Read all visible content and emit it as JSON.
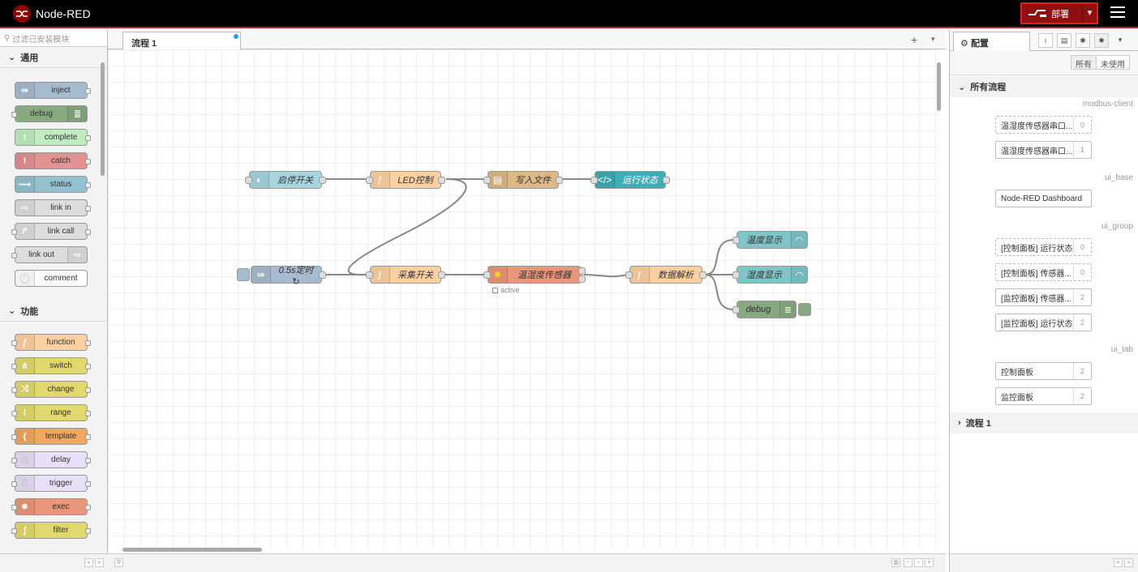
{
  "app": {
    "title": "Node-RED"
  },
  "header": {
    "deploy_label": "部署"
  },
  "palette": {
    "search_placeholder": "过滤已安装模块",
    "categories": [
      {
        "label": "通用",
        "nodes": [
          "inject",
          "debug",
          "complete",
          "catch",
          "status",
          "link in",
          "link call",
          "link out",
          "comment"
        ]
      },
      {
        "label": "功能",
        "nodes": [
          "function",
          "switch",
          "change",
          "range",
          "template",
          "delay",
          "trigger",
          "exec",
          "filter"
        ]
      }
    ]
  },
  "workspace": {
    "tabs": [
      {
        "label": "流程 1"
      }
    ],
    "nodes": {
      "start_stop": "启停开关",
      "led_ctrl": "LED控制",
      "write_file": "写入文件",
      "run_state": "运行状态",
      "timer": "0.5s定时 ↻",
      "collect": "采集开关",
      "sensor": "温湿度传感器",
      "sensor_status": "active",
      "parse": "数据解析",
      "temp_display": "温度显示",
      "humid_display": "湿度显示",
      "debug": "debug"
    }
  },
  "sidebar": {
    "active_tab": "配置",
    "filter": {
      "all": "所有",
      "unused": "未使用"
    },
    "sections": {
      "all_flows": "所有流程",
      "flow1": "流程 1"
    },
    "groups": [
      {
        "type": "modbus-client",
        "items": [
          {
            "label": "温湿度传感器串口...",
            "count": "0",
            "unused": true
          },
          {
            "label": "温湿度传感器串口...",
            "count": "1",
            "unused": false
          }
        ]
      },
      {
        "type": "ui_base",
        "items": [
          {
            "label": "Node-RED Dashboard",
            "count": "",
            "unused": false
          }
        ]
      },
      {
        "type": "ui_group",
        "items": [
          {
            "label": "[控制面板] 运行状态",
            "count": "0",
            "unused": true
          },
          {
            "label": "[控制面板] 传感器...",
            "count": "0",
            "unused": true
          },
          {
            "label": "[监控面板] 传感器...",
            "count": "2",
            "unused": false
          },
          {
            "label": "[监控面板] 运行状态",
            "count": "2",
            "unused": false
          }
        ]
      },
      {
        "type": "ui_tab",
        "items": [
          {
            "label": "控制面板",
            "count": "2",
            "unused": false
          },
          {
            "label": "监控面板",
            "count": "2",
            "unused": false
          }
        ]
      }
    ]
  },
  "colors": {
    "header_bg": "#000000",
    "deploy": "#8f1010",
    "accent": "#c02020"
  }
}
